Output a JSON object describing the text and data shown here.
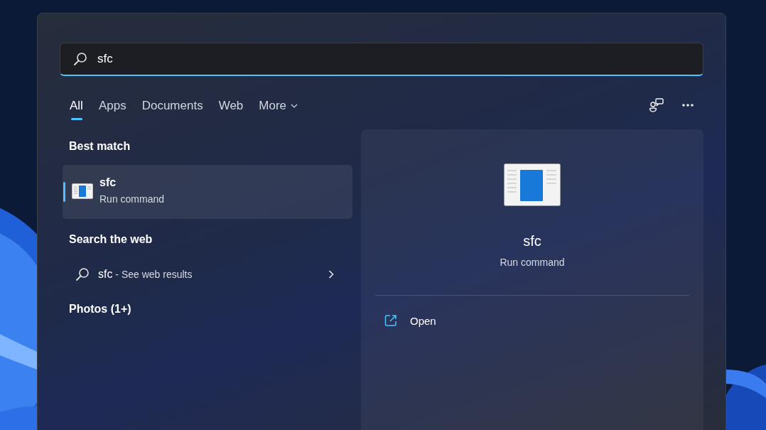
{
  "search": {
    "value": "sfc"
  },
  "tabs": [
    {
      "label": "All",
      "selected": true,
      "kind": "tab"
    },
    {
      "label": "Apps",
      "selected": false,
      "kind": "tab"
    },
    {
      "label": "Documents",
      "selected": false,
      "kind": "tab"
    },
    {
      "label": "Web",
      "selected": false,
      "kind": "tab"
    },
    {
      "label": "More",
      "selected": false,
      "kind": "menu"
    }
  ],
  "best_match": {
    "heading": "Best match",
    "item": {
      "title": "sfc",
      "subtitle": "Run command",
      "selected": true
    }
  },
  "web": {
    "heading": "Search the web",
    "query": "sfc",
    "suffix": " - See web results"
  },
  "photos": {
    "heading": "Photos (1+)"
  },
  "preview": {
    "title": "sfc",
    "subtitle": "Run command",
    "actions": [
      {
        "label": "Open"
      }
    ]
  }
}
